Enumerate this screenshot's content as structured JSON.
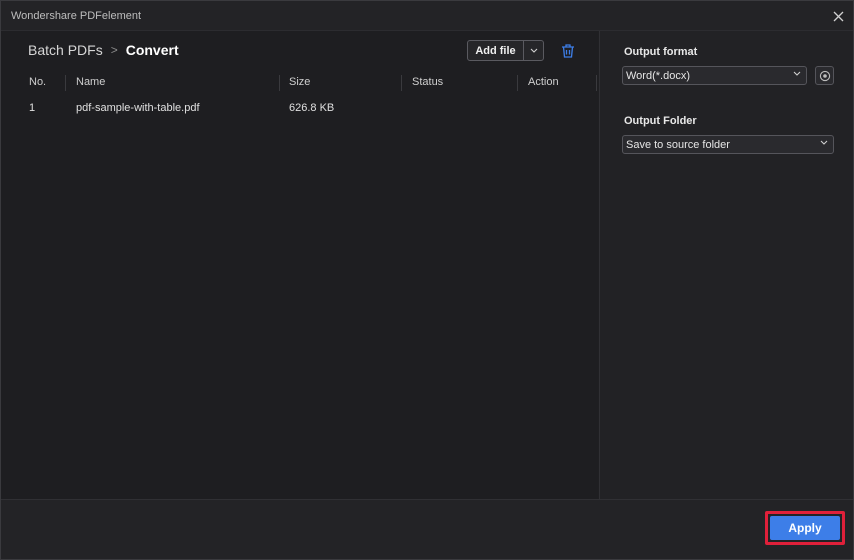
{
  "window": {
    "title": "Wondershare PDFelement"
  },
  "breadcrumb": {
    "root": "Batch PDFs",
    "separator": ">",
    "current": "Convert"
  },
  "toolbar": {
    "add_file_label": "Add file",
    "add_file_dropdown_icon": "chevron-down-icon",
    "delete_icon": "trash-icon"
  },
  "table": {
    "columns": [
      "No.",
      "Name",
      "Size",
      "Status",
      "Action"
    ],
    "rows": [
      {
        "no": "1",
        "name": "pdf-sample-with-table.pdf",
        "size": "626.8 KB",
        "status": "",
        "action": ""
      }
    ]
  },
  "settings": {
    "output_format_label": "Output format",
    "output_format_value": "Word(*.docx)",
    "output_folder_label": "Output Folder",
    "output_folder_value": "Save to source folder"
  },
  "footer": {
    "apply_label": "Apply"
  },
  "colors": {
    "accent": "#3d7ee8",
    "highlight": "#e0203a",
    "background": "#1f1f22"
  }
}
